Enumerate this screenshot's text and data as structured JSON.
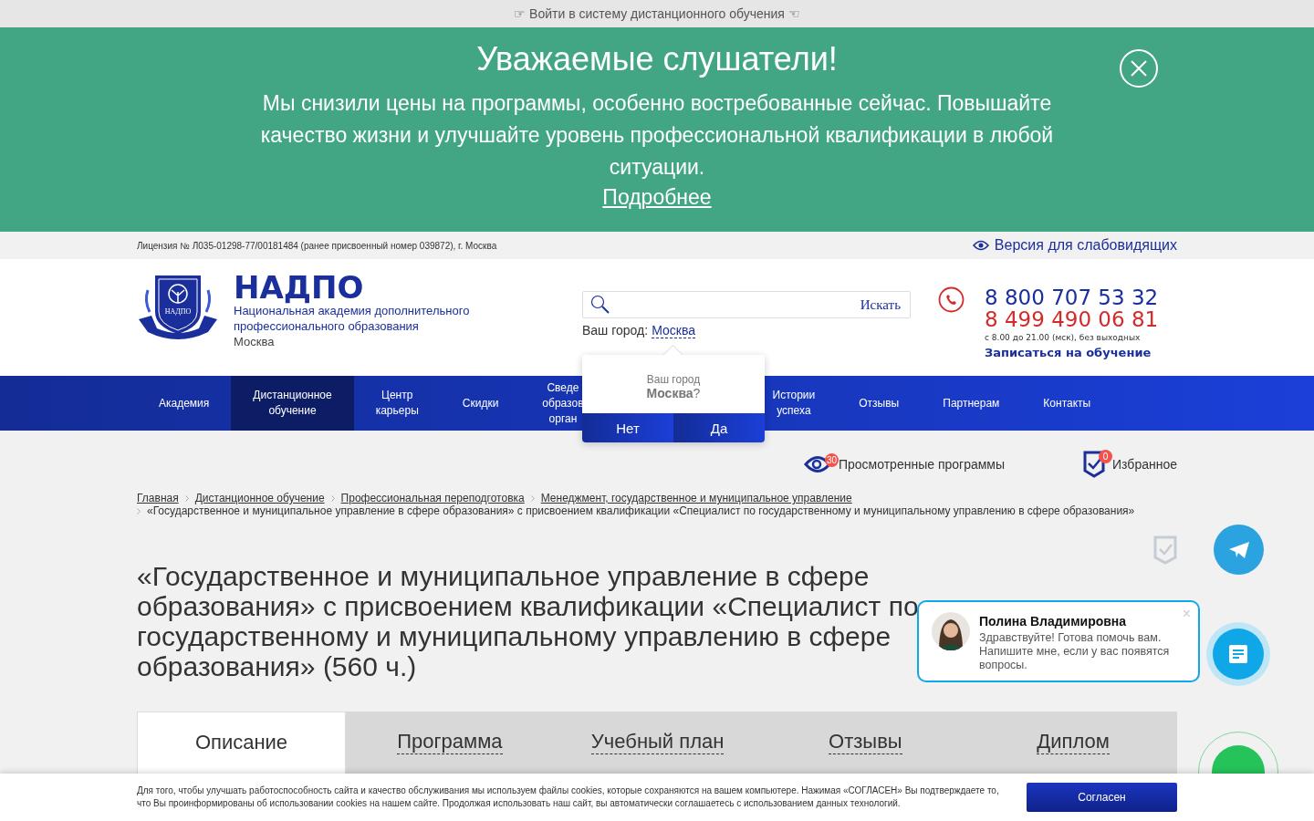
{
  "top_link": "☞ Войти в систему дистанционного обучения ☜",
  "announcement": {
    "title": "Уважаемые слушатели!",
    "text": "Мы снизили цены на программы, особенно востребованные сейчас. Повышайте качество жизни и улучшайте уровень профессиональной квалификации в любой ситуации.",
    "link": "Подробнее"
  },
  "license": "Лицензия № Л035-01298-77/00181484 (ранее присвоенный номер 039872), г. Москва",
  "low_vision_link": "Версия для слабовидящих",
  "logo": {
    "emblem_text": "НАДПО",
    "name": "НАДПО",
    "subtitle": "Национальная академия дополнительного профессионального образования",
    "city": "Москва"
  },
  "search": {
    "button": "Искать"
  },
  "city": {
    "label": "Ваш город:",
    "value": "Москва"
  },
  "city_popup": {
    "question": "Ваш город",
    "city": "**Москва**?",
    "buttons": [
      "Нет",
      "Да"
    ]
  },
  "contacts": {
    "phones": [
      "8 800 707 53 32",
      "8 499 490 06 81"
    ],
    "hours": "с 8.00 до 21.00 (мск), без выходных",
    "signup": "Записаться на обучение"
  },
  "nav": [
    {
      "label": "Академия",
      "selected": false,
      "kind": "item"
    },
    {
      "label": "Дистанционное обучение",
      "selected": true,
      "kind": "item"
    },
    {
      "label": "Центр карьеры",
      "selected": false,
      "kind": "item"
    },
    {
      "label": "Скидки",
      "selected": false,
      "kind": "item"
    },
    {
      "label": "Сведе образов орган",
      "selected": false,
      "kind": "covered"
    },
    {
      "label": "Истории успеха",
      "selected": false,
      "kind": "item"
    },
    {
      "label": "Отзывы",
      "selected": false,
      "kind": "item"
    },
    {
      "label": "Партнерам",
      "selected": false,
      "kind": "item"
    },
    {
      "label": "Контакты",
      "selected": false,
      "kind": "item"
    }
  ],
  "viewed": {
    "label": "Просмотренные программы",
    "count": "30"
  },
  "favorites": {
    "label": "Избранное",
    "count": "0"
  },
  "breadcrumbs": [
    "Главная",
    "Дистанционное обучение",
    "Профессиональная переподготовка",
    "Менеджмент, государственное и муниципальное управление"
  ],
  "breadcrumb_current": "«Государственное и муниципальное управление в сфере образования» с присвоением квалификации «Специалист по государственному и муниципальному управлению в сфере образования»",
  "title": "«Государственное и муниципальное управление в сфере образования» с присвоением квалификации «Специалист по государственному и муниципальному управлению в сфере образования» (560 ч.)",
  "tabs": [
    {
      "label": "Описание",
      "selected": true
    },
    {
      "label": "Программа",
      "selected": false
    },
    {
      "label": "Учебный план",
      "selected": false
    },
    {
      "label": "Отзывы",
      "selected": false
    },
    {
      "label": "Диплом",
      "selected": false
    }
  ],
  "chat": {
    "name": "Полина Владимировна",
    "message": "Здравствуйте! Готова помочь вам. Напишите мне, если у вас появятся вопросы.",
    "close": "×"
  },
  "cookie": {
    "text": "Для того, чтобы улучшать работоспособность сайта и качество обслуживания мы используем файлы cookies, которые сохраняются на вашем компьютере. Нажимая «СОГЛАСЕН» Вы подтверждаете то, что Вы проинформированы об использовании cookies на нашем сайте. Продолжая использовать наш сайт, вы автоматически соглашаетесь с использованием данных технологий.",
    "button": "Согласен"
  }
}
